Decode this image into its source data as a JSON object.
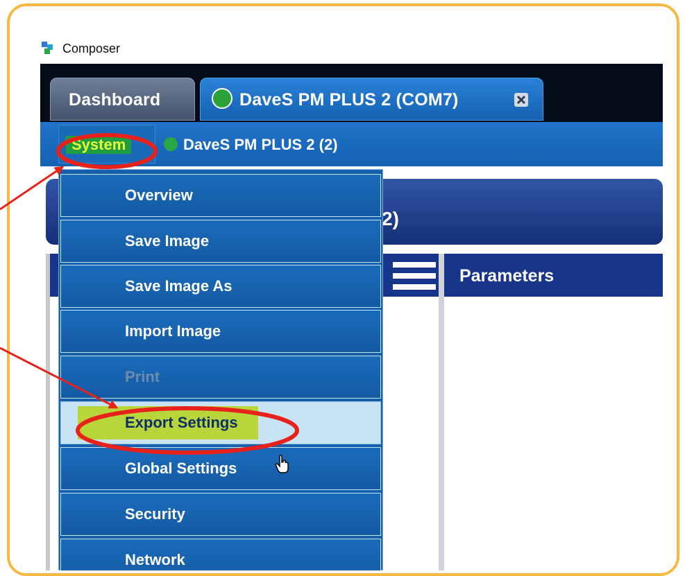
{
  "app": {
    "title": "Composer"
  },
  "tabs": [
    {
      "label": "Dashboard"
    },
    {
      "label": "DaveS PM PLUS 2 (COM7)"
    }
  ],
  "breadcrumb": {
    "system_label": "System",
    "device_label": "DaveS PM PLUS 2 (2)"
  },
  "header": {
    "title_visible": "2)"
  },
  "panes": {
    "parameters_label": "Parameters"
  },
  "system_menu": {
    "items": [
      {
        "label": "Overview",
        "state": "normal"
      },
      {
        "label": "Save Image",
        "state": "normal"
      },
      {
        "label": "Save Image As",
        "state": "normal"
      },
      {
        "label": "Import Image",
        "state": "normal"
      },
      {
        "label": "Print",
        "state": "disabled"
      },
      {
        "label": "Export Settings",
        "state": "highlighted"
      },
      {
        "label": "Global Settings",
        "state": "normal"
      },
      {
        "label": "Security",
        "state": "normal"
      },
      {
        "label": "Network",
        "state": "normal"
      }
    ]
  },
  "annotations": {
    "frame_color": "#f5b942",
    "circle_color": "#e8221b",
    "arrow_color": "#e8221b",
    "highlight_color": "#b8d63a"
  }
}
